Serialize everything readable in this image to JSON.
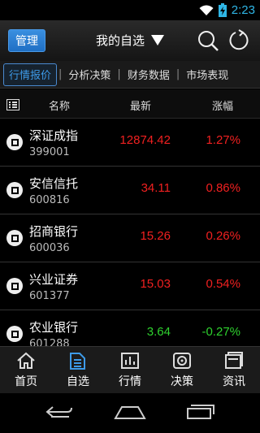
{
  "status": {
    "time": "2:23"
  },
  "header": {
    "manage_label": "管理",
    "title": "我的自选"
  },
  "tabs": [
    {
      "label": "行情报价",
      "active": true
    },
    {
      "label": "分析决策"
    },
    {
      "label": "财务数据"
    },
    {
      "label": "市场表现"
    }
  ],
  "table": {
    "columns": [
      "名称",
      "最新",
      "涨幅"
    ],
    "rows": [
      {
        "name": "深证成指",
        "code": "399001",
        "price": "12874.42",
        "change": "1.27%",
        "dir": "up"
      },
      {
        "name": "安信信托",
        "code": "600816",
        "price": "34.11",
        "change": "0.86%",
        "dir": "up"
      },
      {
        "name": "招商银行",
        "code": "600036",
        "price": "15.26",
        "change": "0.26%",
        "dir": "up"
      },
      {
        "name": "兴业证券",
        "code": "601377",
        "price": "15.03",
        "change": "0.54%",
        "dir": "up"
      },
      {
        "name": "农业银行",
        "code": "601288",
        "price": "3.64",
        "change": "-0.27%",
        "dir": "down"
      }
    ]
  },
  "bottom_nav": [
    {
      "label": "首页",
      "icon": "home-icon"
    },
    {
      "label": "自选",
      "icon": "favorites-icon",
      "active": true
    },
    {
      "label": "行情",
      "icon": "chart-icon"
    },
    {
      "label": "决策",
      "icon": "decision-icon"
    },
    {
      "label": "资讯",
      "icon": "news-icon"
    }
  ],
  "colors": {
    "accent": "#3d9ae8",
    "up": "#f02020",
    "down": "#2ed12e"
  }
}
